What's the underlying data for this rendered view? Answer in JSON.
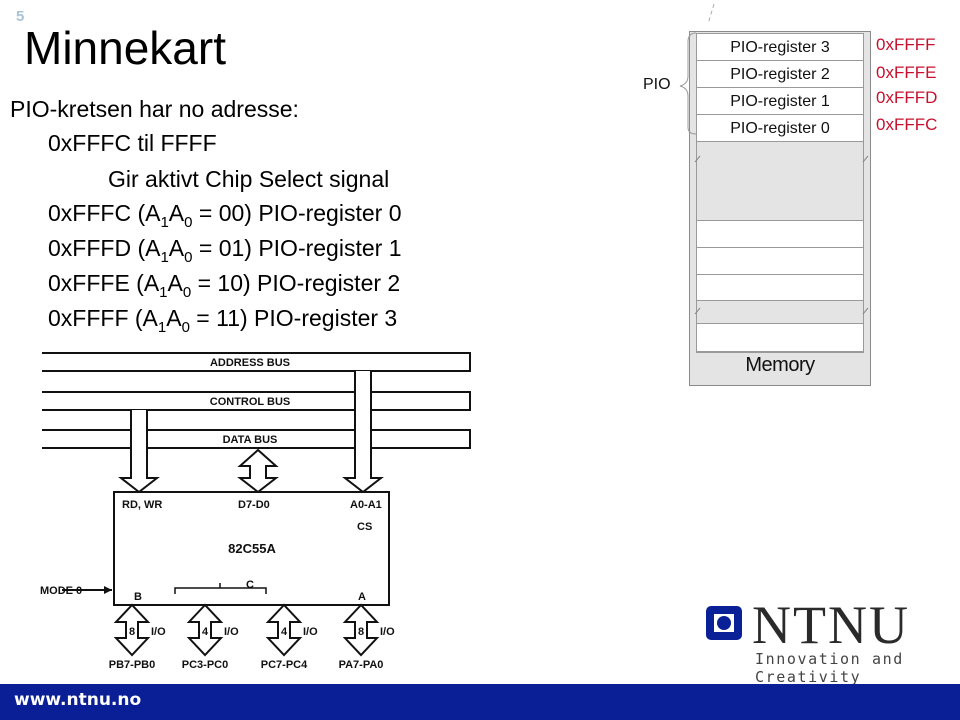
{
  "slide": {
    "number": "5",
    "title": "Minnekart"
  },
  "body": {
    "line1": "PIO-kretsen har no adresse:",
    "line2": "0xFFFC til FFFF",
    "line3": "Gir aktivt Chip Select signal",
    "mappings": [
      {
        "addr": "0xFFFC (A",
        "s1": "1",
        "mid": "A",
        "s0": "0",
        "rest": " = 00) PIO-register 0"
      },
      {
        "addr": "0xFFFD (A",
        "s1": "1",
        "mid": "A",
        "s0": "0",
        "rest": " = 01) PIO-register 1"
      },
      {
        "addr": "0xFFFE (A",
        "s1": "1",
        "mid": "A",
        "s0": "0",
        "rest": " = 10) PIO-register 2"
      },
      {
        "addr": "0xFFFF (A",
        "s1": "1",
        "mid": "A",
        "s0": "0",
        "rest": " = 11) PIO-register 3"
      }
    ]
  },
  "memory_map": {
    "group_label": "PIO",
    "registers": [
      {
        "name": "PIO-register 3",
        "address": "0xFFFF"
      },
      {
        "name": "PIO-register 2",
        "address": "0xFFFE"
      },
      {
        "name": "PIO-register 1",
        "address": "0xFFFD"
      },
      {
        "name": "PIO-register 0",
        "address": "0xFFFC"
      }
    ],
    "label": "Memory",
    "address_color": "#c8102e"
  },
  "circuit": {
    "buses": [
      "ADDRESS BUS",
      "CONTROL BUS",
      "DATA BUS"
    ],
    "chip": "82C55A",
    "top_pins": {
      "control": "RD, WR",
      "data": "D7-D0",
      "address": "A0-A1",
      "cs": "CS"
    },
    "mode": "MODE 0",
    "ports": {
      "b": "B",
      "c": "C",
      "a": "A"
    },
    "io": [
      {
        "width": "8",
        "label": "I/O",
        "pins": "PB7-PB0"
      },
      {
        "width": "4",
        "label": "I/O",
        "pins": "PC3-PC0"
      },
      {
        "width": "4",
        "label": "I/O",
        "pins": "PC7-PC4"
      },
      {
        "width": "8",
        "label": "I/O",
        "pins": "PA7-PA0"
      }
    ]
  },
  "branding": {
    "logo_text": "NTNU",
    "tagline": "Innovation and Creativity",
    "url": "www.ntnu.no",
    "brand_color": "#0a1e96"
  }
}
